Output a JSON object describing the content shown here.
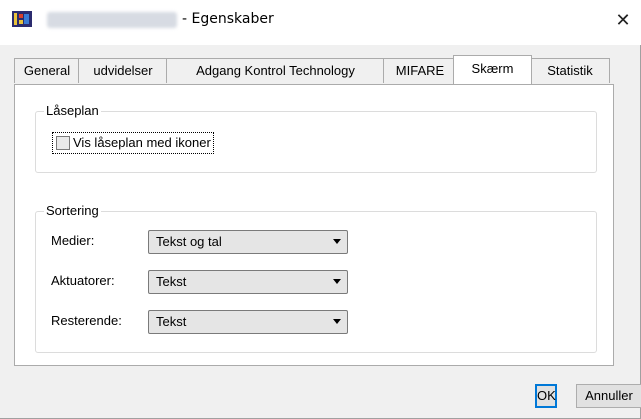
{
  "window": {
    "title": "- Egenskaber",
    "close_glyph": "✕"
  },
  "tabs": [
    {
      "label": "General",
      "active": false
    },
    {
      "label": "udvidelser",
      "active": false
    },
    {
      "label": "Adgang Kontrol Technology",
      "active": false
    },
    {
      "label": "MIFARE",
      "active": false
    },
    {
      "label": "Skærm",
      "active": true
    },
    {
      "label": "Statistik",
      "active": false
    }
  ],
  "laseplan": {
    "legend": "Låseplan",
    "checkbox_label": "Vis låseplan med ikoner",
    "checked": false
  },
  "sortering": {
    "legend": "Sortering",
    "rows": [
      {
        "label": "Medier:",
        "value": "Tekst og tal"
      },
      {
        "label": "Aktuatorer:",
        "value": "Tekst"
      },
      {
        "label": "Resterende:",
        "value": "Tekst"
      }
    ]
  },
  "buttons": {
    "ok": "OK",
    "cancel": "Annuller"
  },
  "colors": {
    "accent": "#0078d7",
    "window_bg": "#f0f0f0",
    "panel_bg": "#ffffff"
  }
}
